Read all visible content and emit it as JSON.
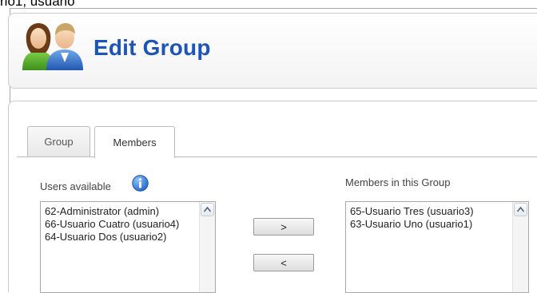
{
  "breadcrumb": "rio1, usuario",
  "header": {
    "title": "Edit Group"
  },
  "tabs": [
    {
      "label": "Group"
    },
    {
      "label": "Members"
    }
  ],
  "available": {
    "label": "Users available",
    "items": [
      "62-Administrator (admin)",
      "66-Usuario Cuatro (usuario4)",
      "64-Usuario Dos (usuario2)"
    ]
  },
  "members": {
    "label": "Members in this Group",
    "items": [
      "65-Usuario Tres (usuario3)",
      "63-Usuario Uno (usuario1)"
    ]
  },
  "buttons": {
    "add": ">",
    "remove": "<"
  },
  "icons": {
    "header": "users-group-icon",
    "info": "info-icon"
  },
  "colors": {
    "title": "#1c55b7",
    "info": "#1a6fd6"
  }
}
